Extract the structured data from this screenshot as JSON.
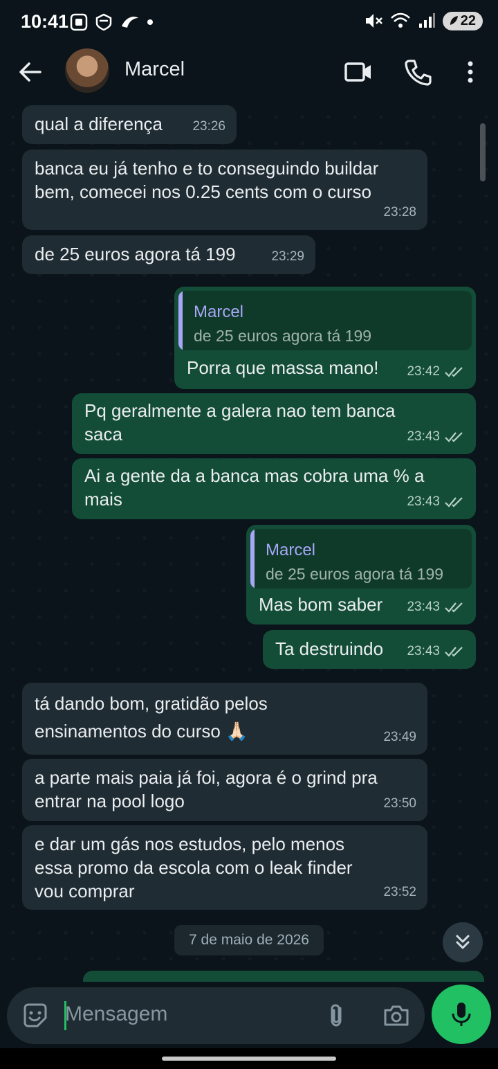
{
  "status_bar": {
    "time": "10:41",
    "battery": "22"
  },
  "header": {
    "contact_name": "Marcel"
  },
  "messages": [
    {
      "dir": "in",
      "text": "qual a diferença",
      "time": "23:26"
    },
    {
      "dir": "in",
      "text": "banca eu já tenho e to conseguindo buildar\nbem, comecei nos 0.25 cents com o curso",
      "time": "23:28"
    },
    {
      "dir": "in",
      "text": "de 25 euros agora tá 199",
      "time": "23:29"
    },
    {
      "dir": "out",
      "quote_name": "Marcel",
      "quote_text": "de 25 euros agora tá 199",
      "text": "Porra que massa mano!",
      "time": "23:42"
    },
    {
      "dir": "out",
      "text": "Pq geralmente a galera nao tem banca\nsaca",
      "time": "23:43"
    },
    {
      "dir": "out",
      "text": "Ai a gente da a banca mas cobra uma % a\nmais",
      "time": "23:43"
    },
    {
      "dir": "out",
      "quote_name": "Marcel",
      "quote_text": "de 25 euros agora tá 199",
      "text": "Mas bom saber",
      "time": "23:43"
    },
    {
      "dir": "out",
      "text": "Ta destruindo",
      "time": "23:43"
    },
    {
      "dir": "in",
      "text": "tá dando bom, gratidão pelos\nensinamentos do curso 🙏🏻",
      "time": "23:49"
    },
    {
      "dir": "in",
      "text": "a parte mais paia já foi, agora é o grind pra\nentrar na pool logo",
      "time": "23:50"
    },
    {
      "dir": "in",
      "text": "e dar um gás nos estudos, pelo menos\nessa promo da escola com o leak finder\nvou comprar",
      "time": "23:52"
    }
  ],
  "date_divider": "7 de maio de 2026",
  "composer": {
    "placeholder": "Mensagem"
  },
  "colors": {
    "accent": "#21c063",
    "incoming": "#202c33",
    "outgoing": "#144d37",
    "background": "#0b141a"
  }
}
